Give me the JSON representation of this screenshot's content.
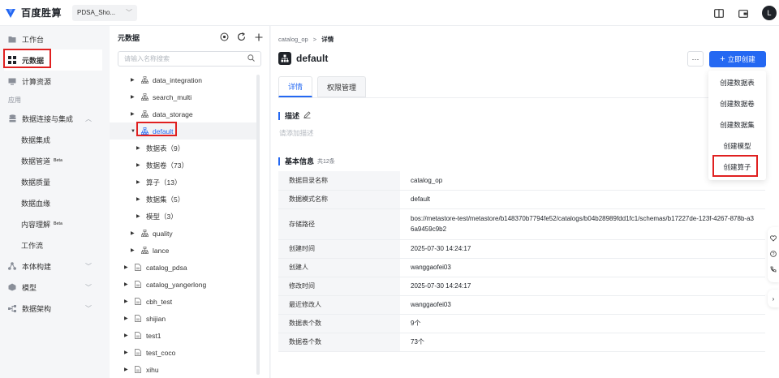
{
  "brand": {
    "name": "百度胜算"
  },
  "workspace": {
    "value": "PDSA_Sho..."
  },
  "avatar": {
    "initial": "L"
  },
  "nav": {
    "items": [
      {
        "label": "工作台",
        "icon": "folder-icon"
      },
      {
        "label": "元数据",
        "icon": "grid-icon"
      },
      {
        "label": "计算资源",
        "icon": "monitor-icon"
      }
    ],
    "section": "应用",
    "integration": {
      "label": "数据连接与集成"
    },
    "subs": [
      {
        "label": "数据集成",
        "beta": ""
      },
      {
        "label": "数据管道",
        "beta": "Beta"
      },
      {
        "label": "数据质量",
        "beta": ""
      },
      {
        "label": "数据血缘",
        "beta": ""
      },
      {
        "label": "内容理解",
        "beta": "Beta"
      },
      {
        "label": "工作流",
        "beta": ""
      }
    ],
    "groups": [
      {
        "label": "本体构建"
      },
      {
        "label": "模型"
      },
      {
        "label": "数据架构"
      }
    ]
  },
  "tree": {
    "title": "元数据",
    "search_placeholder": "请输入名称搜索",
    "rows": [
      {
        "label": "data_integration",
        "level": 1,
        "type": "schema"
      },
      {
        "label": "search_multi",
        "level": 1,
        "type": "schema"
      },
      {
        "label": "data_storage",
        "level": 1,
        "type": "schema"
      },
      {
        "label": "default",
        "level": 1,
        "type": "schema",
        "expanded": true,
        "selected": true
      },
      {
        "label": "数据表（9）",
        "level": 2,
        "type": "group"
      },
      {
        "label": "数据卷（73）",
        "level": 2,
        "type": "group"
      },
      {
        "label": "算子（13）",
        "level": 2,
        "type": "group"
      },
      {
        "label": "数据集（5）",
        "level": 2,
        "type": "group"
      },
      {
        "label": "模型（3）",
        "level": 2,
        "type": "group"
      },
      {
        "label": "quality",
        "level": 1,
        "type": "schema"
      },
      {
        "label": "lance",
        "level": 1,
        "type": "schema"
      },
      {
        "label": "catalog_pdsa",
        "level": 0,
        "type": "catalog"
      },
      {
        "label": "catalog_yangerlong",
        "level": 0,
        "type": "catalog"
      },
      {
        "label": "cbh_test",
        "level": 0,
        "type": "catalog"
      },
      {
        "label": "shijian",
        "level": 0,
        "type": "catalog"
      },
      {
        "label": "test1",
        "level": 0,
        "type": "catalog"
      },
      {
        "label": "test_coco",
        "level": 0,
        "type": "catalog"
      },
      {
        "label": "xihu",
        "level": 0,
        "type": "catalog"
      }
    ]
  },
  "main": {
    "breadcrumb": {
      "parent": "catalog_op",
      "sep": ">",
      "current": "详情"
    },
    "title": "default",
    "more_label": "···",
    "create_label": "立即创建",
    "tabs": [
      {
        "label": "详情"
      },
      {
        "label": "权限管理"
      }
    ],
    "desc": {
      "title": "描述",
      "placeholder": "请添加描述"
    },
    "info": {
      "title": "基本信息",
      "count": "共12条",
      "rows": [
        {
          "k": "数据目录名称",
          "v": "catalog_op"
        },
        {
          "k": "数据模式名称",
          "v": "default"
        },
        {
          "k": "存储路径",
          "v": "bos://metastore-test/metastore/b148370b7794fe52/catalogs/b04b28989fdd1fc1/schemas/b17227de-123f-4267-878b-a36a9459c9b2"
        },
        {
          "k": "创建时间",
          "v": "2025-07-30 14:24:17"
        },
        {
          "k": "创建人",
          "v": "wanggaofei03"
        },
        {
          "k": "修改时间",
          "v": "2025-07-30 14:24:17"
        },
        {
          "k": "最近修改人",
          "v": "wanggaofei03"
        },
        {
          "k": "数据表个数",
          "v": "9个"
        },
        {
          "k": "数据卷个数",
          "v": "73个"
        }
      ]
    }
  },
  "dropdown": {
    "items": [
      "创建数据表",
      "创建数据卷",
      "创建数据集",
      "创建模型",
      "创建算子"
    ]
  },
  "colors": {
    "accent": "#2468f2",
    "highlight": "#e02020"
  }
}
